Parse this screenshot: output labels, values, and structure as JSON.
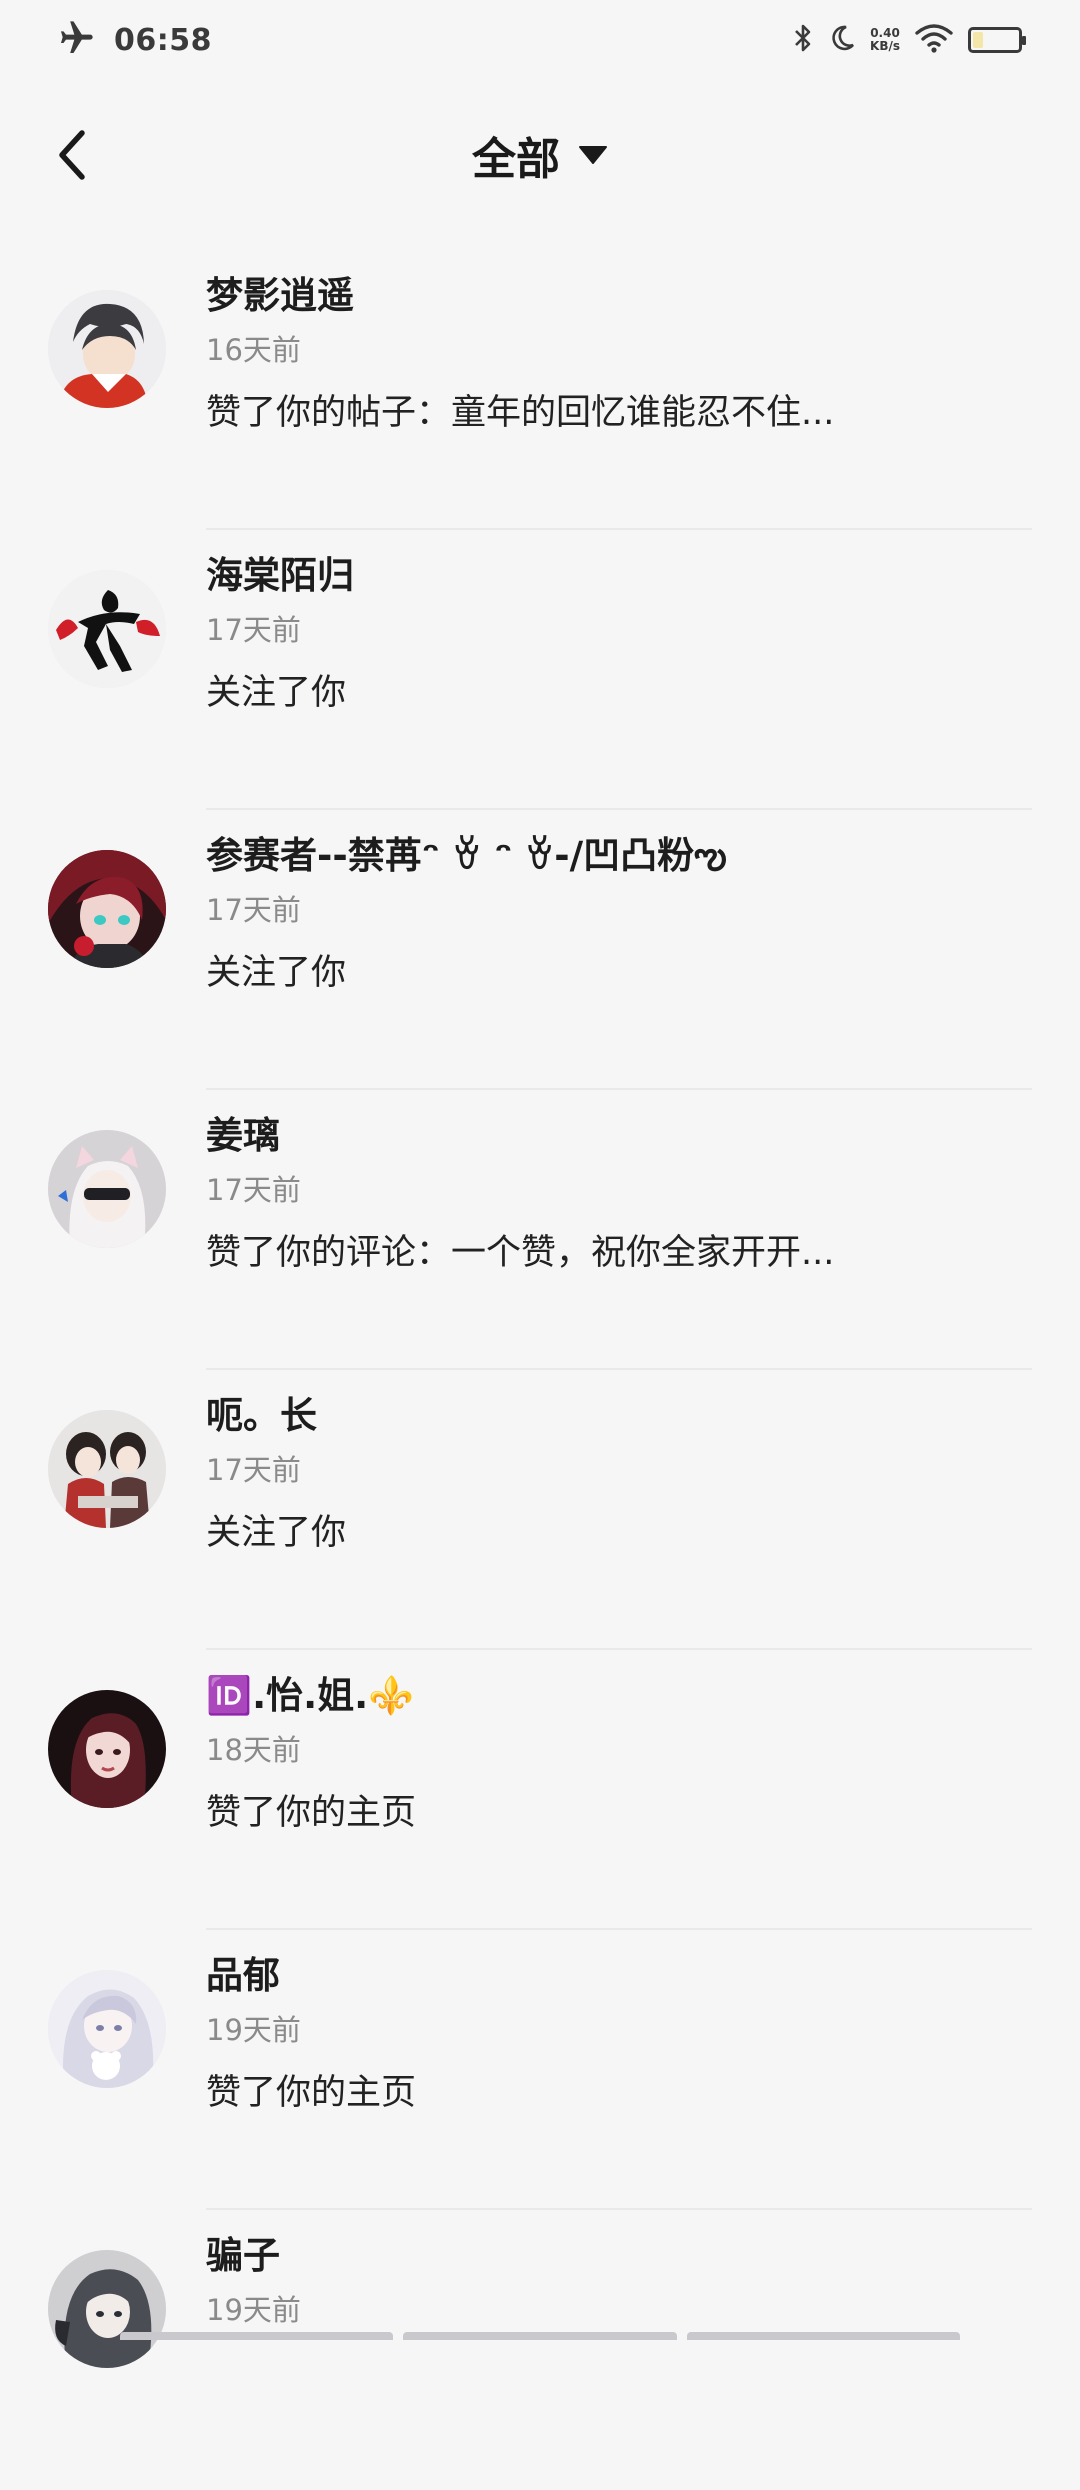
{
  "status_bar": {
    "time": "06:58",
    "net_speed_value": "0.40",
    "net_speed_unit": "KB/s",
    "icons": [
      "airplane-icon",
      "bluetooth-icon",
      "moon-icon",
      "wifi-icon",
      "battery-icon"
    ]
  },
  "header": {
    "title": "全部",
    "back_icon": "chevron-left-icon",
    "dropdown_icon": "caret-down-icon"
  },
  "notifications": [
    {
      "username": "梦影逍遥",
      "time": "16天前",
      "action": "赞了你的帖子：童年的回忆谁能忍不住...",
      "avatar_color": "#c93a2c"
    },
    {
      "username": "海棠陌归",
      "time": "17天前",
      "action": "关注了你",
      "avatar_color": "#1f1f1f"
    },
    {
      "username": "参赛者--禁苒ᵔ ꈊ ᵔ ꈊ-/凹凸粉ఌ",
      "time": "17天前",
      "action": "关注了你",
      "avatar_color": "#8a1f2a"
    },
    {
      "username": "姜璃",
      "time": "17天前",
      "action": "赞了你的评论：一个赞，祝你全家开开...",
      "avatar_color": "#d8d4d6"
    },
    {
      "username": "呃。长",
      "time": "17天前",
      "action": "关注了你",
      "avatar_color": "#6a3b3b"
    },
    {
      "username": "🆔.怡.姐.⚜️",
      "time": "18天前",
      "action": "赞了你的主页",
      "avatar_color": "#3a1f23"
    },
    {
      "username": "品郁",
      "time": "19天前",
      "action": "赞了你的主页",
      "avatar_color": "#c9c8d6"
    },
    {
      "username": "骗子",
      "time": "19天前",
      "action": "",
      "avatar_color": "#5c5e64"
    }
  ]
}
